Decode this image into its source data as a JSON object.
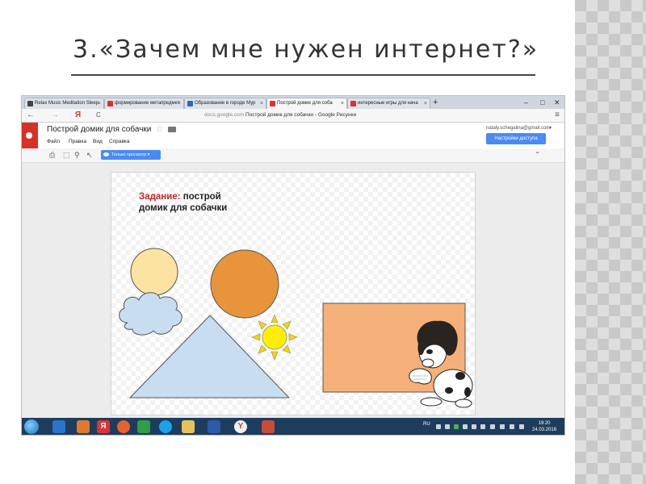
{
  "slide": {
    "title": "3.«Зачем  мне нужен интернет?»"
  },
  "browser": {
    "tabs": [
      {
        "label": "Relax Music Meditation Sleep",
        "favicon_color": "#444444",
        "active": false
      },
      {
        "label": "формирование метапредмет",
        "favicon_color": "#e03030",
        "active": false
      },
      {
        "label": "Образование в городе Мур",
        "favicon_color": "#2a6ab8",
        "active": false
      },
      {
        "label": "Построй домик для соба",
        "favicon_color": "#e03030",
        "active": true
      },
      {
        "label": "интересные игры для нача",
        "favicon_color": "#e03030",
        "active": false
      }
    ],
    "new_tab": "+",
    "window_controls": {
      "minimize": "–",
      "maximize": "□",
      "close": "✕"
    },
    "nav": {
      "back": "←",
      "forward": "→",
      "yandex": "Я",
      "reload": "C"
    },
    "url_host": "docs.google.com",
    "url_title": "Построй домик для собачки - Google Рисунки",
    "menu_icon": "≡"
  },
  "app": {
    "doc_title": "Построй домик для собачки",
    "menu": [
      "Файл",
      "Правка",
      "Вид",
      "Справка"
    ],
    "user_email": "nataly.schegalina@gmail.com",
    "share_button": "Настройки доступа",
    "toolbar": {
      "view_mode_label": "Только просмотр ▾"
    },
    "accent_color": "#4a8af4",
    "logo_color": "#d93025"
  },
  "canvas": {
    "task_label": "Задание:",
    "task_text_1": "построй",
    "task_text_2": "домик для собачки",
    "shapes": {
      "small_circle_color": "#fde3a1",
      "big_circle_color": "#e8943a",
      "cloud_color": "#c9ddf1",
      "triangle_color": "#c9ddf1",
      "sun_color": "#ffee00",
      "sun_ray_color": "#f5d600",
      "rectangle_color": "#f5b07a"
    }
  },
  "taskbar": {
    "language": "RU",
    "time": "19:20",
    "date": "24.03.2016"
  }
}
